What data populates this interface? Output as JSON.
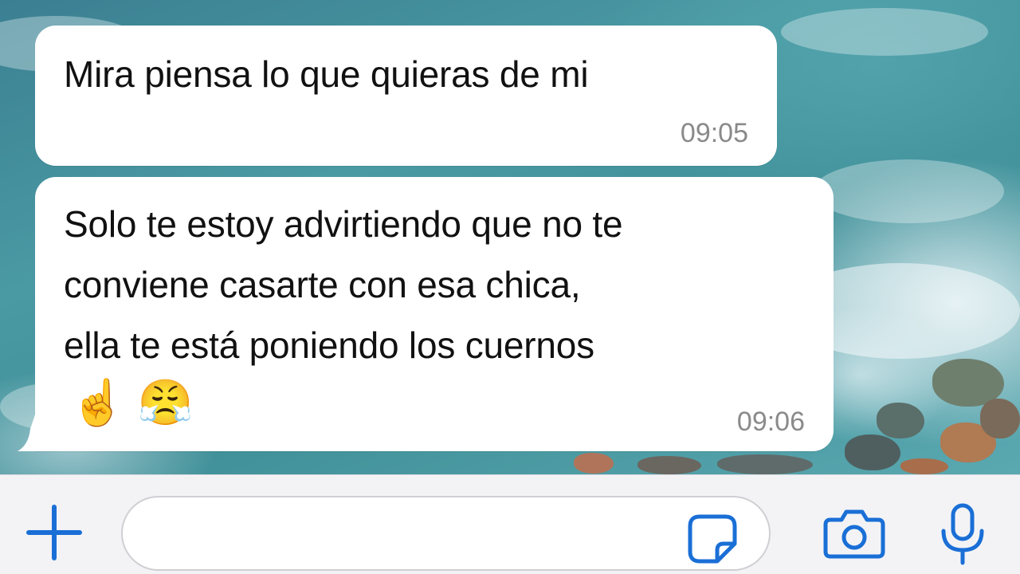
{
  "chat": {
    "messages": [
      {
        "lines": [
          "Mira piensa lo que quieras de mi"
        ],
        "time": "09:05"
      },
      {
        "lines": [
          "Solo te estoy advirtiendo que no te",
          "conviene casarte con esa chica,",
          "ella te está poniendo los cuernos"
        ],
        "emoji": "☝️ 😤",
        "time": "09:06"
      }
    ]
  },
  "composer": {
    "placeholder": "",
    "icons": [
      "plus-icon",
      "sticker-icon",
      "camera-icon",
      "microphone-icon"
    ],
    "accent_color": "#1a6fd6"
  },
  "colors": {
    "bubble": "#ffffff",
    "text": "#111111",
    "timestamp": "#8a8a8a",
    "bar_background": "#f3f3f6"
  }
}
